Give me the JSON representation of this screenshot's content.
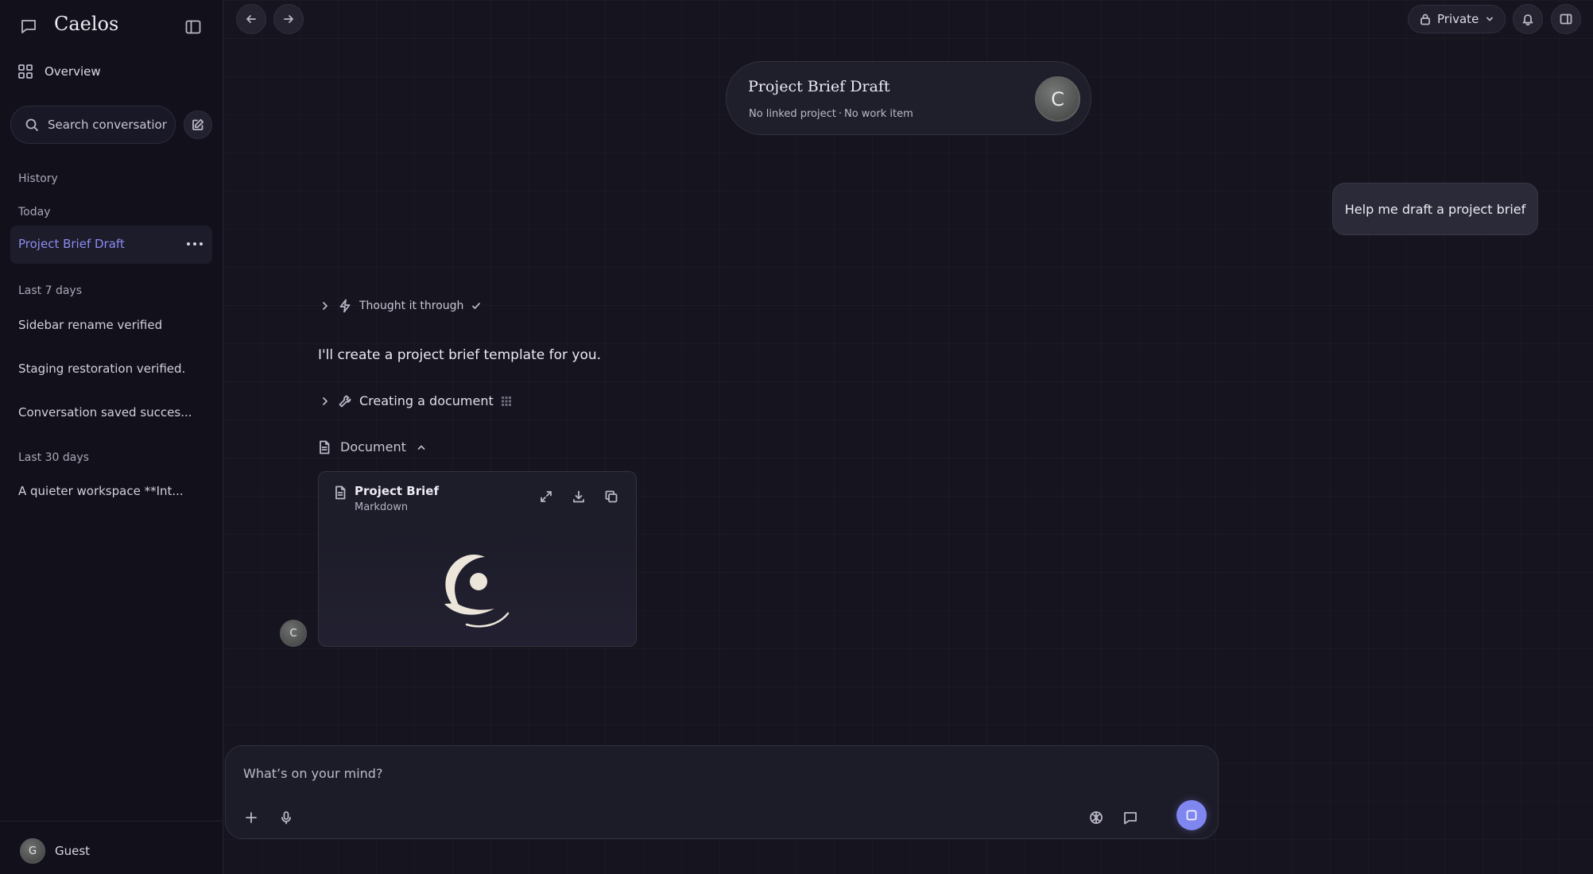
{
  "app": {
    "name": "Caelos"
  },
  "sidebar": {
    "overview_label": "Overview",
    "search_placeholder": "Search conversations",
    "history_label": "History",
    "sections": {
      "today": "Today",
      "last7": "Last 7 days",
      "last30": "Last 30 days"
    },
    "today_items": [
      "Project Brief Draft"
    ],
    "last7_items": [
      "Sidebar rename verified",
      "Staging restoration verified.",
      "Conversation saved succes..."
    ],
    "last30_items": [
      "A quieter workspace **Int..."
    ],
    "user": {
      "initial": "G",
      "name": "Guest"
    }
  },
  "topbar": {
    "visibility_label": "Private"
  },
  "header": {
    "title": "Project Brief Draft",
    "project": "No linked project",
    "separator": "·",
    "work_item": "No work item",
    "avatar_initial": "C"
  },
  "conversation": {
    "user_message": "Help me draft a project brief",
    "thought_label": "Thought it through",
    "assistant_text": "I'll create a project brief template for you.",
    "tool_label": "Creating a document",
    "document_section_label": "Document",
    "document": {
      "title": "Project Brief",
      "type": "Markdown"
    },
    "assistant_initial": "C"
  },
  "composer": {
    "placeholder": "What’s on your mind?"
  },
  "colors": {
    "accent": "#7f86ef",
    "active_item_text": "#8b8cf0",
    "background": "#15141f"
  }
}
